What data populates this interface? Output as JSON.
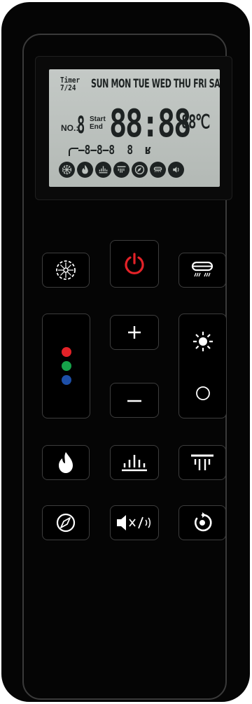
{
  "lcd": {
    "timer_label": "Timer",
    "timer_sub": "7/24",
    "days": [
      "SUN",
      "MON",
      "TUE",
      "WED",
      "THU",
      "FRI",
      "SAT"
    ],
    "no_label": "NO.:",
    "no_digit": "8",
    "start_label": "Start",
    "end_label": "End",
    "clock": "88:88",
    "temp": "88℃",
    "segments": "–8–8–8  8  ʁ",
    "icons": [
      "heater-wheel-icon",
      "flame-icon",
      "flame-height-icon",
      "heat-fan-icon",
      "compass-icon",
      "fan-mode-icon",
      "sound-icon"
    ]
  },
  "colors": {
    "body": "#050505",
    "lcd_bg": "#bcc2be",
    "power_red": "#e32228",
    "led_red": "#e32228",
    "led_green": "#16a34a",
    "led_blue": "#1d4fa8",
    "button_border": "#3d3d3d"
  },
  "buttons": {
    "plus": "+",
    "minus": "–",
    "sound_mute": "x/"
  }
}
